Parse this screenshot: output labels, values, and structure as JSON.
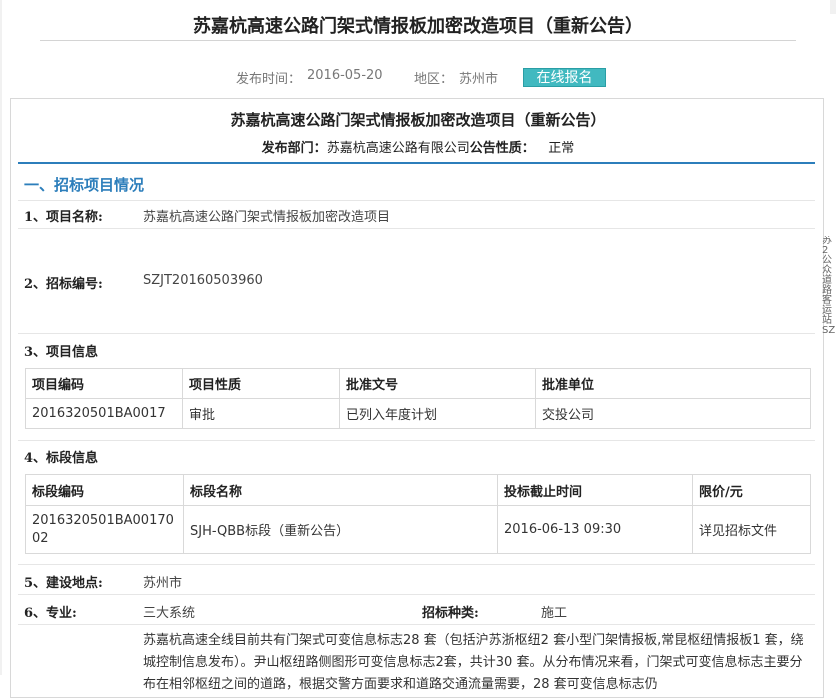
{
  "page_title": "苏嘉杭高速公路门架式情报板加密改造项目（重新公告）",
  "meta": {
    "publish_label": "发布时间：",
    "publish_date": "2016-05-20",
    "region_label": "地区：",
    "region": "苏州市",
    "signup_button": "在线报名"
  },
  "notice": {
    "title": "苏嘉杭高速公路门架式情报板加密改造项目（重新公告）",
    "dept_label": "发布部门：",
    "dept_value": "苏嘉杭高速公路有限公司",
    "nature_label": "公告性质：",
    "nature_value": "正常"
  },
  "section1": {
    "heading": "一、招标项目情况",
    "project_name_label": "1、项目名称:",
    "project_name": "苏嘉杭高速公路门架式情报板加密改造项目",
    "tender_no_label": "2、招标编号:",
    "tender_no": "SZJT20160503960",
    "project_info_label": "3、项目信息",
    "project_table": {
      "headers": [
        "项目编码",
        "项目性质",
        "批准文号",
        "批准单位"
      ],
      "rows": [
        [
          "2016320501BA0017",
          "审批",
          "已列入年度计划",
          "交投公司"
        ]
      ]
    },
    "lot_info_label": "4、标段信息",
    "lot_table": {
      "headers": [
        "标段编码",
        "标段名称",
        "投标截止时间",
        "限价/元"
      ],
      "rows": [
        [
          "2016320501BA0017002",
          "SJH-QBB标段（重新公告）",
          "2016-06-13 09:30",
          "详见招标文件"
        ]
      ]
    },
    "site_label": "5、建设地点:",
    "site": "苏州市",
    "major_label": "6、专业:",
    "major": "三大系统",
    "tender_type_label": "招标种类:",
    "tender_type": "施工",
    "description": "苏嘉杭高速全线目前共有门架式可变信息标志28 套（包括沪苏浙枢纽2 套小型门架情报板,常昆枢纽情报板1 套，绕城控制信息发布）。尹山枢纽路侧图形可变信息标志2套，共计30 套。从分布情况来看，门架式可变信息标志主要分布在相邻枢纽之间的道路，根据交警方面要求和道路交通流量需要，28 套可变信息标志仍"
  },
  "side_strip_text": "苏2公众道路客运站SZ"
}
